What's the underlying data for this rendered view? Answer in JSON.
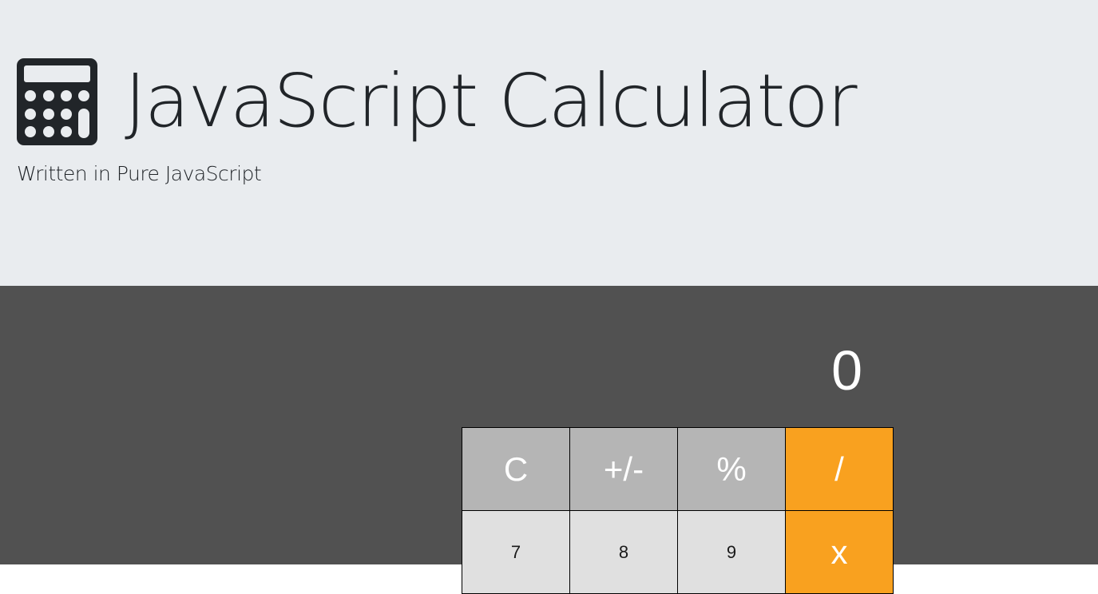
{
  "header": {
    "icon": "calculator-icon",
    "title": "JavaScript Calculator",
    "subtitle": "Written in Pure JavaScript"
  },
  "calculator": {
    "display": "0",
    "row1": {
      "clear": "C",
      "negate": "+/-",
      "percent": "%",
      "divide": "/"
    },
    "row2": {
      "seven": "7",
      "eight": "8",
      "nine": "9",
      "multiply": "x"
    }
  },
  "colors": {
    "hero_background": "#e9ecef",
    "calc_background": "#515151",
    "function_key": "#b5b5b5",
    "operator_key": "#f9a11f",
    "number_key": "#e0e0e0"
  }
}
